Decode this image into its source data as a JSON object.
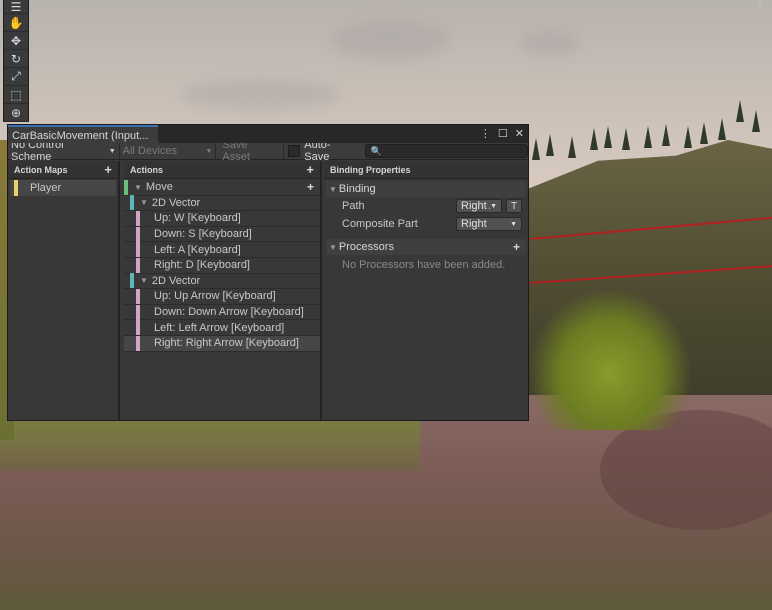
{
  "scene": {
    "toolbar_icons": [
      "hand-icon",
      "move-icon",
      "rotate-icon",
      "scale-icon",
      "rect-icon",
      "transform-icon"
    ],
    "corner_menu_glyph": "⋮"
  },
  "window": {
    "tab_title": "CarBasicMovement (Input...",
    "buttons": {
      "more": "⋮",
      "maximize": "☐",
      "close": "✕"
    },
    "toolbar": {
      "control_scheme": "No Control Scheme",
      "devices": "All Devices",
      "save_asset": "Save Asset",
      "auto_save": "Auto-Save",
      "search_placeholder": ""
    }
  },
  "action_maps": {
    "header": "Action Maps",
    "items": [
      {
        "label": "Player",
        "color": "#e8d46a"
      }
    ]
  },
  "actions": {
    "header": "Actions",
    "rows": [
      {
        "type": "action",
        "label": "Move",
        "expanded": true
      },
      {
        "type": "comp",
        "label": "2D Vector",
        "expanded": true
      },
      {
        "type": "part",
        "label": "Up: W [Keyboard]"
      },
      {
        "type": "part",
        "label": "Down: S [Keyboard]"
      },
      {
        "type": "part",
        "label": "Left: A [Keyboard]"
      },
      {
        "type": "part",
        "label": "Right: D [Keyboard]"
      },
      {
        "type": "comp",
        "label": "2D Vector",
        "expanded": true
      },
      {
        "type": "part",
        "label": "Up: Up Arrow [Keyboard]"
      },
      {
        "type": "part",
        "label": "Down: Down Arrow [Keyboard]"
      },
      {
        "type": "part",
        "label": "Left: Left Arrow [Keyboard]"
      },
      {
        "type": "part",
        "label": "Right: Right Arrow [Keyboard]",
        "selected": true
      }
    ]
  },
  "properties": {
    "header": "Binding Properties",
    "binding_section": "Binding",
    "path_label": "Path",
    "path_value": "Right A",
    "t_button": "T",
    "composite_label": "Composite Part",
    "composite_value": "Right",
    "processors_section": "Processors",
    "processors_empty": "No Processors have been added."
  },
  "colors": {
    "action_bar": "#69bf7e",
    "composite_bar": "#5eb5b5",
    "part_bar": "#d3a4c4",
    "map_bar": "#e8d46a",
    "tab_accent": "#3a72b0"
  }
}
